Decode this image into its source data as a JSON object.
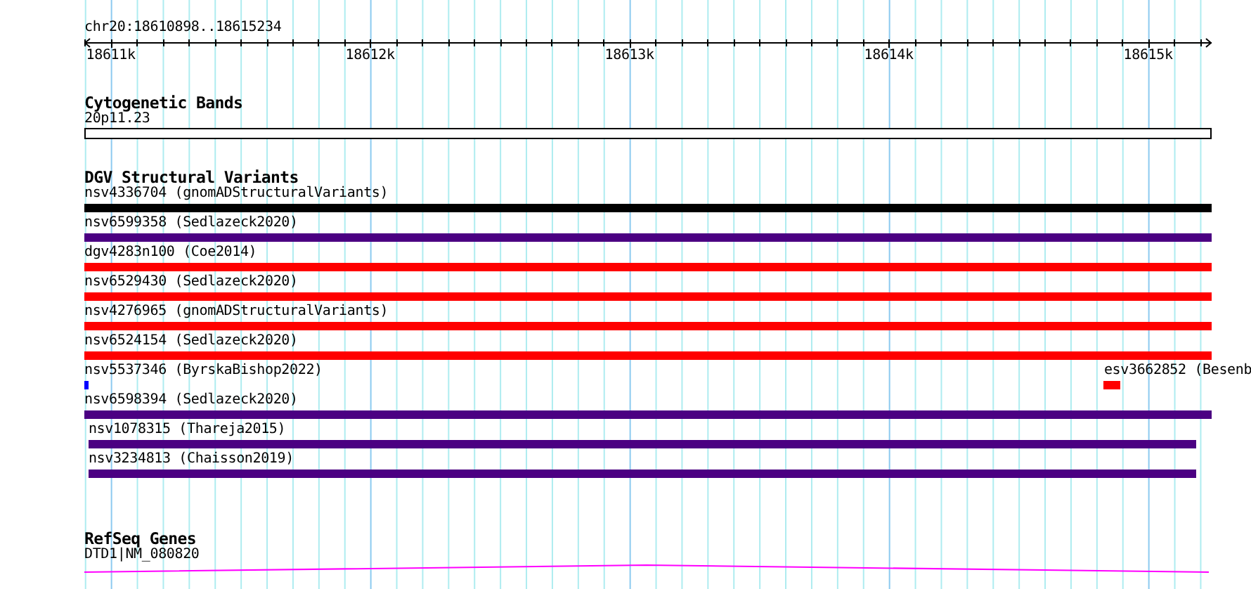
{
  "ruler": {
    "location": "chr20:18610898..18615234",
    "ticks": [
      {
        "label": "18611k"
      },
      {
        "label": "18612k"
      },
      {
        "label": "18613k"
      },
      {
        "label": "18614k"
      },
      {
        "label": "18615k"
      }
    ]
  },
  "tracks": [
    {
      "kind": "cytoband",
      "title": "Cytogenetic Bands",
      "rows": [
        {
          "features": [
            {
              "label": "20p11.23"
            }
          ]
        }
      ]
    },
    {
      "kind": "variants",
      "title": "DGV Structural Variants",
      "rows": [
        {
          "features": [
            {
              "label": "nsv4336704 (gnomADStructuralVariants)",
              "color": "#000000"
            }
          ]
        },
        {
          "features": [
            {
              "label": "nsv6599358 (Sedlazeck2020)",
              "color": "#4b0082"
            }
          ]
        },
        {
          "features": [
            {
              "label": "dgv4283n100 (Coe2014)",
              "color": "#ff0000"
            }
          ]
        },
        {
          "features": [
            {
              "label": "nsv6529430 (Sedlazeck2020)",
              "color": "#ff0000"
            }
          ]
        },
        {
          "features": [
            {
              "label": "nsv4276965 (gnomADStructuralVariants)",
              "color": "#ff0000"
            }
          ]
        },
        {
          "features": [
            {
              "label": "nsv6524154 (Sedlazeck2020)",
              "color": "#ff0000"
            }
          ]
        },
        {
          "features": [
            {
              "label": "nsv5537346 (ByrskaBishop2022)",
              "color": "#0000ff"
            },
            {
              "label": "esv3662852 (Besenb",
              "color": "#ff0000"
            }
          ]
        },
        {
          "features": [
            {
              "label": "nsv6598394 (Sedlazeck2020)",
              "color": "#4b0082"
            }
          ]
        },
        {
          "features": [
            {
              "label": "nsv1078315 (Thareja2015)",
              "color": "#4b0082"
            }
          ]
        },
        {
          "features": [
            {
              "label": "nsv3234813 (Chaisson2019)",
              "color": "#4b0082"
            }
          ]
        }
      ]
    },
    {
      "kind": "gene",
      "title": "RefSeq Genes",
      "rows": [
        {
          "features": [
            {
              "label": "DTD1|NM_080820"
            }
          ]
        }
      ]
    }
  ]
}
